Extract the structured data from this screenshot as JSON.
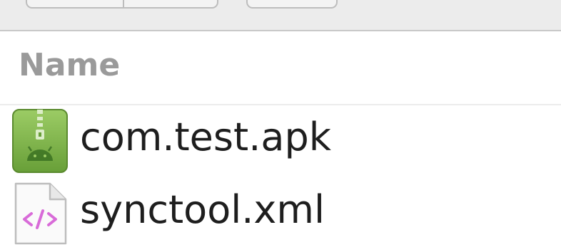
{
  "file_list": {
    "column_header": "Name",
    "files": [
      {
        "name": "com.test.apk",
        "icon": "android-package-icon"
      },
      {
        "name": "synctool.xml",
        "icon": "xml-code-file-icon"
      }
    ]
  },
  "colors": {
    "apk_icon_green": "#7cb342",
    "xml_icon_tag": "#d86bd8",
    "header_text": "#9a9a9a",
    "file_text": "#1e1e1e"
  }
}
